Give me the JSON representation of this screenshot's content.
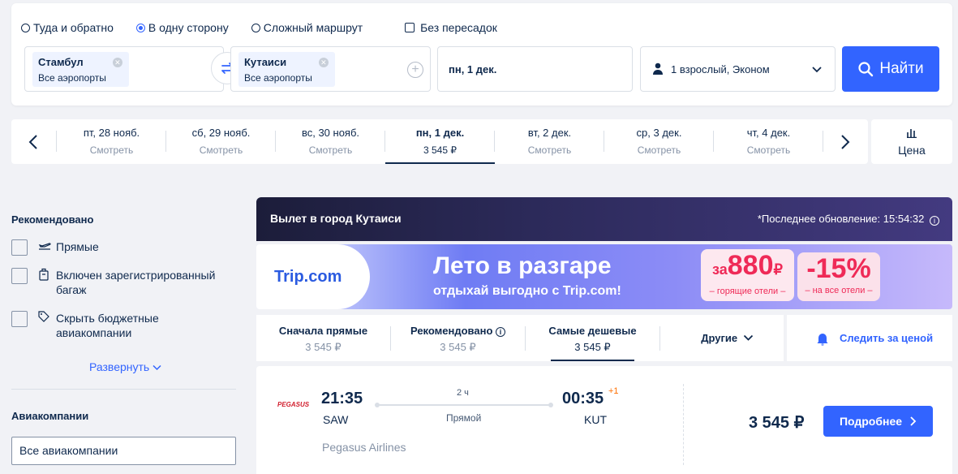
{
  "search": {
    "trip_types": [
      {
        "label": "Туда и обратно",
        "selected": false
      },
      {
        "label": "В одну сторону",
        "selected": true
      },
      {
        "label": "Сложный маршрут",
        "selected": false
      }
    ],
    "nonstop_label": "Без пересадок",
    "from": {
      "city": "Стамбул",
      "sub": "Все аэропорты"
    },
    "to": {
      "city": "Кутаиси",
      "sub": "Все аэропорты"
    },
    "date": "пн, 1 дек.",
    "passengers": "1 взрослый, Эконом",
    "search_button": "Найти"
  },
  "dates": [
    {
      "day": "пт, 28 нояб.",
      "price": "Смотреть",
      "active": false
    },
    {
      "day": "сб, 29 нояб.",
      "price": "Смотреть",
      "active": false
    },
    {
      "day": "вс, 30 нояб.",
      "price": "Смотреть",
      "active": false
    },
    {
      "day": "пн, 1 дек.",
      "price": "3 545 ₽",
      "active": true
    },
    {
      "day": "вт, 2 дек.",
      "price": "Смотреть",
      "active": false
    },
    {
      "day": "ср, 3 дек.",
      "price": "Смотреть",
      "active": false
    },
    {
      "day": "чт, 4 дек.",
      "price": "Смотреть",
      "active": false
    }
  ],
  "price_button": "Цена",
  "filters": {
    "recommended_title": "Рекомендовано",
    "items": [
      {
        "label": "Прямые"
      },
      {
        "label": "Включен зарегистрированный багаж"
      },
      {
        "label": "Скрыть бюджетные авиакомпании"
      }
    ],
    "expand_label": "Развернуть",
    "airlines_title": "Авиакомпании",
    "airlines_select": "Все авиакомпании"
  },
  "results": {
    "heading": "Вылет в город Кутаиси",
    "updated": "*Последнее обновление: 15:54:32",
    "banner": {
      "logo": "Trip.com",
      "title": "Лето в разгаре",
      "subtitle": "отдыхай выгодно с Trip.com!",
      "promo1_prefix": "за",
      "promo1_value": "880",
      "promo1_currency": "₽",
      "promo1_caption": "– горящие отели –",
      "promo2_value": "-15%",
      "promo2_caption": "– на все отели –"
    },
    "sort": [
      {
        "label": "Сначала прямые",
        "price": "3 545 ₽",
        "active": false
      },
      {
        "label": "Рекомендовано",
        "price": "3 545 ₽",
        "active": false
      },
      {
        "label": "Самые дешевые",
        "price": "3 545 ₽",
        "active": true
      },
      {
        "label": "Другие",
        "price": "",
        "active": false
      }
    ],
    "track_price": "Следить за ценой",
    "flights": [
      {
        "airline_logo": "PEGASUS",
        "depart_time": "21:35",
        "depart_airport": "SAW",
        "duration": "2 ч",
        "stops": "Прямой",
        "arrive_time": "00:35",
        "day_offset": "+1",
        "arrive_airport": "KUT",
        "airline": "Pegasus Airlines",
        "price": "3 545 ₽",
        "details_button": "Подробнее"
      }
    ]
  },
  "colors": {
    "accent": "#3264ff",
    "text": "#0f294d",
    "muted": "#8592a6",
    "background": "#f1f2f6"
  }
}
